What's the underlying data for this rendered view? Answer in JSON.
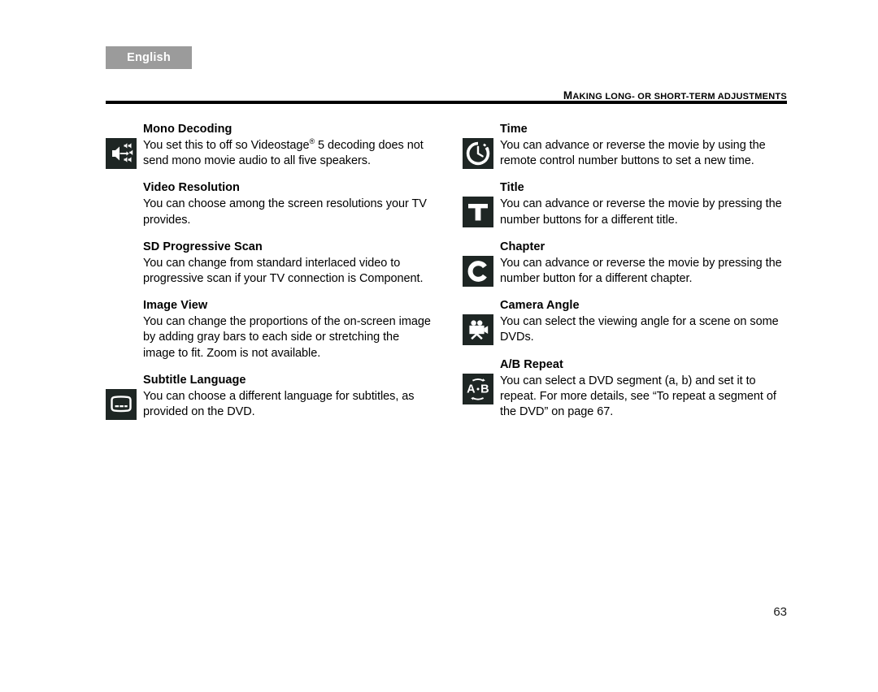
{
  "language_tab": {
    "label": "English"
  },
  "running_head": {
    "lead": "M",
    "rest": "AKING LONG- OR SHORT-TERM ADJUSTMENTS",
    "full": "MAKING LONG- OR SHORT-TERM ADJUSTMENTS"
  },
  "left_column": [
    {
      "icon": "mono-decoding-icon",
      "has_icon": true,
      "title": "Mono Decoding",
      "text_before": "You set this to off so Videostage",
      "superscript": "®",
      "text_after": " 5 decoding does not send mono movie audio to all five speakers."
    },
    {
      "icon": null,
      "has_icon": false,
      "title": "Video Resolution",
      "text": "You can choose among the screen resolutions your TV provides."
    },
    {
      "icon": null,
      "has_icon": false,
      "title": "SD Progressive Scan",
      "text": "You can change from standard interlaced video to progressive scan if your TV connection is Component."
    },
    {
      "icon": null,
      "has_icon": false,
      "title": "Image View",
      "text": "You can change the proportions of the on-screen image by adding gray bars to each side or stretching the image to fit. Zoom is not available."
    },
    {
      "icon": "subtitle-screen-icon",
      "has_icon": true,
      "title": "Subtitle Language",
      "text": "You can choose a different language for subtitles, as provided on the DVD."
    }
  ],
  "right_column": [
    {
      "icon": "clock-icon",
      "has_icon": true,
      "title": "Time",
      "text": "You can advance or reverse the movie by using the remote control number buttons to set a new time."
    },
    {
      "icon": "letter-t-icon",
      "has_icon": true,
      "title": "Title",
      "text": "You can advance or reverse the movie by pressing the number buttons for a different title."
    },
    {
      "icon": "letter-c-icon",
      "has_icon": true,
      "title": "Chapter",
      "text": "You can advance or reverse the movie by pressing the number button for a different chapter."
    },
    {
      "icon": "movie-camera-icon",
      "has_icon": true,
      "title": "Camera Angle",
      "text": "You can select the viewing angle for a scene on some DVDs."
    },
    {
      "icon": "ab-repeat-icon",
      "has_icon": true,
      "title": "A/B Repeat",
      "text": "You can select a DVD segment (a, b) and set it to repeat. For more details, see “To repeat a segment of the DVD” on page 67."
    }
  ],
  "folio": {
    "page_number": "63"
  },
  "colors": {
    "tab_background": "#9b9b9b",
    "tab_text": "#ffffff",
    "icon_background": "#1e2624",
    "icon_foreground": "#ffffff",
    "rule": "#000000",
    "body_text": "#000000",
    "page_background": "#ffffff"
  }
}
